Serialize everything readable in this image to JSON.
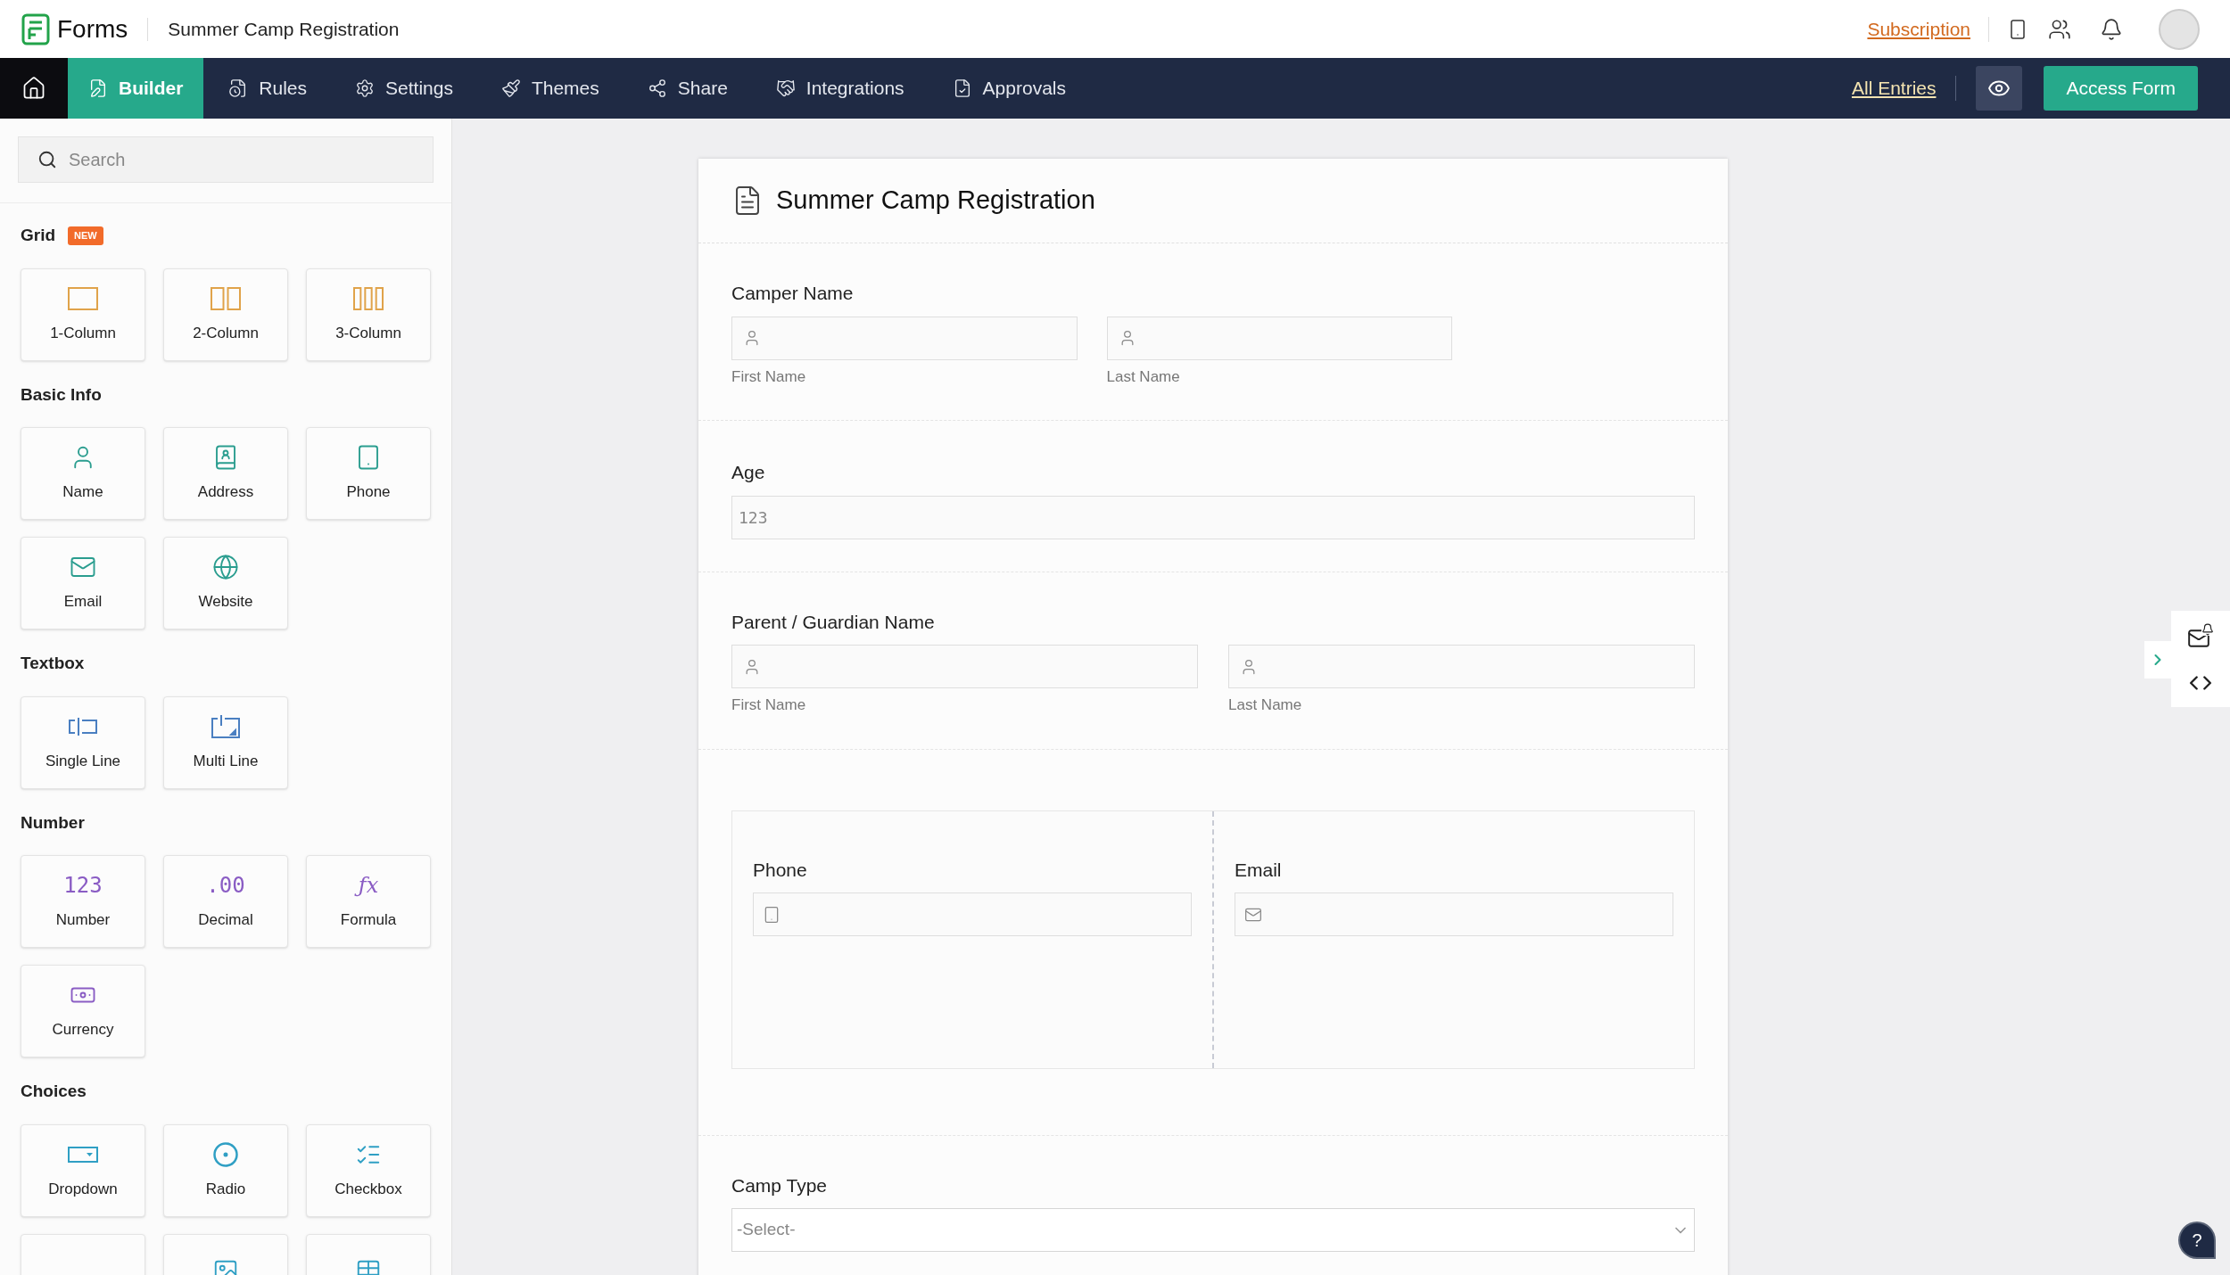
{
  "header": {
    "app_name": "Forms",
    "form_name": "Summer Camp Registration",
    "subscription": "Subscription"
  },
  "nav": {
    "tabs": [
      {
        "label": "Builder",
        "selected": true
      },
      {
        "label": "Rules",
        "selected": false
      },
      {
        "label": "Settings",
        "selected": false
      },
      {
        "label": "Themes",
        "selected": false
      },
      {
        "label": "Share",
        "selected": false
      },
      {
        "label": "Integrations",
        "selected": false
      },
      {
        "label": "Approvals",
        "selected": false
      }
    ],
    "all_entries": "All Entries",
    "access_form": "Access Form"
  },
  "sidebar": {
    "search_placeholder": "Search",
    "sections": [
      {
        "title": "Grid",
        "badge": "NEW",
        "items": [
          {
            "label": "1-Column"
          },
          {
            "label": "2-Column"
          },
          {
            "label": "3-Column"
          }
        ]
      },
      {
        "title": "Basic Info",
        "items": [
          {
            "label": "Name"
          },
          {
            "label": "Address"
          },
          {
            "label": "Phone"
          },
          {
            "label": "Email"
          },
          {
            "label": "Website"
          }
        ]
      },
      {
        "title": "Textbox",
        "items": [
          {
            "label": "Single Line"
          },
          {
            "label": "Multi Line"
          }
        ]
      },
      {
        "title": "Number",
        "items": [
          {
            "label": "Number",
            "icon_text": "123"
          },
          {
            "label": "Decimal",
            "icon_text": ".00"
          },
          {
            "label": "Formula",
            "icon_text": "ƒx"
          },
          {
            "label": "Currency"
          }
        ]
      },
      {
        "title": "Choices",
        "items": [
          {
            "label": "Dropdown"
          },
          {
            "label": "Radio"
          },
          {
            "label": "Checkbox"
          }
        ]
      }
    ]
  },
  "form": {
    "title": "Summer Camp Registration",
    "fields": [
      {
        "kind": "name",
        "label": "Camper Name",
        "wide": false,
        "parts": [
          "First Name",
          "Last Name"
        ]
      },
      {
        "kind": "number",
        "label": "Age",
        "placeholder": "123"
      },
      {
        "kind": "name",
        "label": "Parent / Guardian Name",
        "wide": true,
        "parts": [
          "First Name",
          "Last Name"
        ]
      },
      {
        "kind": "grid",
        "columns": [
          {
            "kind": "phone",
            "label": "Phone"
          },
          {
            "kind": "email",
            "label": "Email"
          }
        ]
      },
      {
        "kind": "select",
        "label": "Camp Type",
        "placeholder": "-Select-"
      }
    ]
  },
  "help": "?"
}
